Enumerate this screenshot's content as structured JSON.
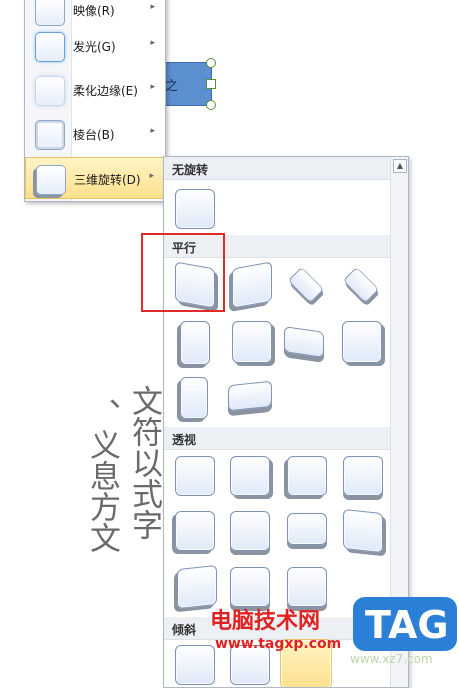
{
  "background": {
    "vertical_text_col1": "文符以式字",
    "vertical_text_col2": "、义息方文",
    "shape_text": "之"
  },
  "effects_menu": {
    "items": [
      {
        "label": "映像(R)"
      },
      {
        "label": "发光(G)"
      },
      {
        "label": "柔化边缘(E)"
      },
      {
        "label": "棱台(B)"
      },
      {
        "label": "三维旋转(D)"
      }
    ],
    "arrow_glyph": "▸"
  },
  "rotation_gallery": {
    "sections": [
      {
        "label": "无旋转"
      },
      {
        "label": "平行"
      },
      {
        "label": "透视"
      },
      {
        "label": "倾斜"
      }
    ],
    "scroll_up_glyph": "▲"
  },
  "watermark": {
    "title": "电脑技术网",
    "url": "www.tagxp.com",
    "logo": "TAG",
    "faint": "www.xz7.com"
  },
  "colors": {
    "highlight_box": "#e02a2a",
    "active_item": "#fde08c",
    "shape_fill": "#5b8fd0"
  }
}
